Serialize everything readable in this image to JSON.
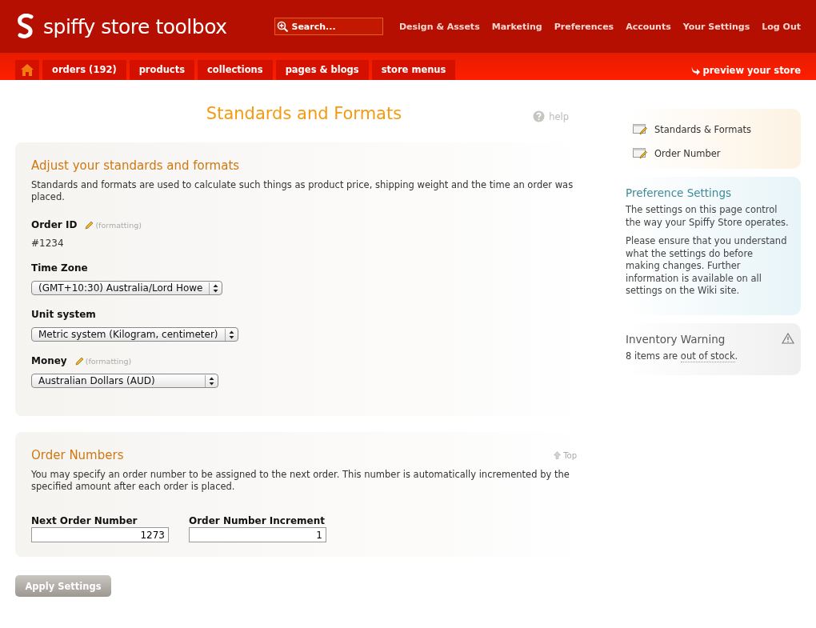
{
  "header": {
    "logo_text": "spiffy store toolbox",
    "search": {
      "placeholder": "Search..."
    },
    "top_links": [
      "Design & Assets",
      "Marketing",
      "Preferences",
      "Accounts",
      "Your Settings",
      "Log Out"
    ],
    "tabs": [
      {
        "kind": "home"
      },
      {
        "kind": "text",
        "label": "orders (192)"
      },
      {
        "kind": "text",
        "label": "products"
      },
      {
        "kind": "text",
        "label": "collections"
      },
      {
        "kind": "text",
        "label": "pages & blogs"
      },
      {
        "kind": "text",
        "label": "store menus"
      }
    ],
    "preview_link": "preview your store"
  },
  "page": {
    "title": "Standards and Formats",
    "help": "help"
  },
  "sections": [
    {
      "title": "Adjust your standards and formats",
      "description": "Standards and formats are used to calculate such things as product price, shipping weight and the time an order was placed.",
      "fields": [
        {
          "kind": "static",
          "label": "Order ID",
          "note": "(formatting)",
          "value": "#1234"
        },
        {
          "kind": "select",
          "label": "Time Zone",
          "value": "(GMT+10:30) Australia/Lord Howe"
        },
        {
          "kind": "select",
          "label": "Unit system",
          "value": "Metric system (Kilogram, centimeter)"
        },
        {
          "kind": "select",
          "label": "Money",
          "note": "(formatting)",
          "value": "Australian Dollars (AUD)"
        }
      ]
    },
    {
      "title": "Order Numbers",
      "top_link": "Top",
      "description": "You may specify an order number to be assigned to the next order. This number is automatically incremented by the specified amount after each order is placed.",
      "inputs": [
        {
          "label": "Next Order Number",
          "value": "1273"
        },
        {
          "label": "Order Number Increment",
          "value": "1"
        }
      ]
    }
  ],
  "apply_button": "Apply Settings",
  "sidebar": {
    "nav": [
      "Standards & Formats",
      "Order Number"
    ],
    "info": {
      "title": "Preference Settings",
      "paragraphs": [
        "The settings on this page control the way your Spiffy Store operates.",
        "Please ensure that you understand what the settings do before making changes. Further information is available on all settings on the Wiki site."
      ]
    },
    "warning": {
      "title": "Inventory Warning",
      "text_before": "8 items are ",
      "link": "out of stock",
      "text_after": "."
    }
  }
}
